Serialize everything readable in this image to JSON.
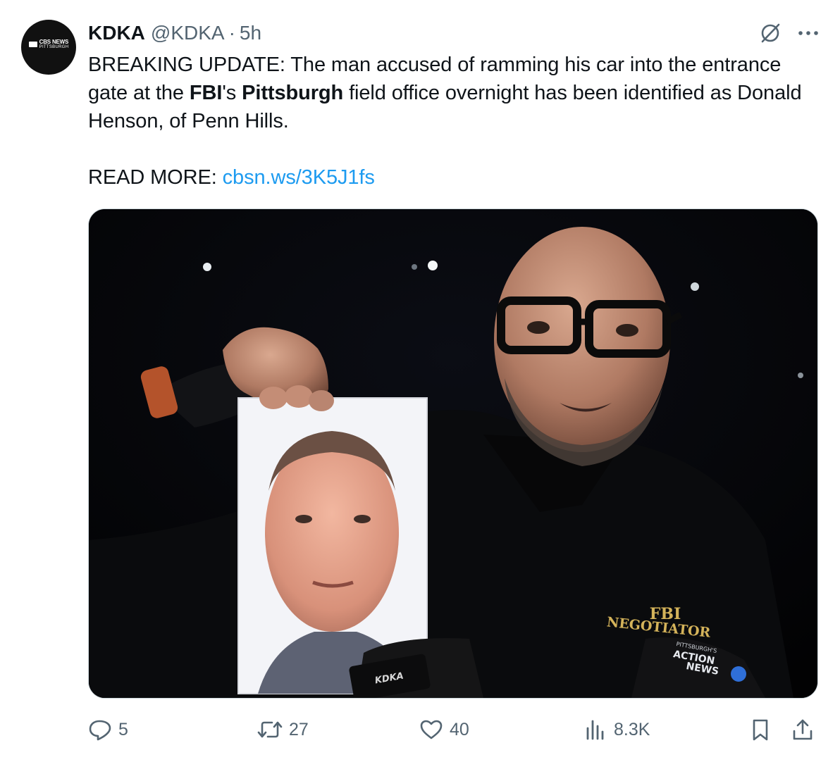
{
  "tweet": {
    "name": "KDKA",
    "handle": "@KDKA",
    "separator": "·",
    "time": "5h",
    "avatar_logo_line1": "CBS NEWS",
    "avatar_logo_line2": "PITTSBURGH",
    "text_segments": [
      "BREAKING UPDATE: The man accused of ramming his car into the entrance gate at the ",
      "FBI",
      "'s ",
      "Pittsburgh",
      " field office overnight has been identified as Donald Henson, of Penn Hills."
    ],
    "read_more_label": "READ MORE:",
    "link_text": "cbsn.ws/3K5J1fs"
  },
  "media": {
    "jacket_text_line1": "FBI",
    "jacket_text_line2": "NEGOTIATOR",
    "mic_left_label": "KDKA",
    "mic_right_label_1": "PITTSBURGH'S",
    "mic_right_label_2": "ACTION",
    "mic_right_label_3": "NEWS"
  },
  "actions": {
    "replies": "5",
    "retweets": "27",
    "likes": "40",
    "views": "8.3K"
  },
  "icons": [
    "grok-icon",
    "more-icon",
    "reply-icon",
    "retweet-icon",
    "like-icon",
    "views-icon",
    "bookmark-icon",
    "share-icon"
  ],
  "colors": {
    "text": "#0f1419",
    "secondary": "#536471",
    "link": "#1d9bf0",
    "border": "#cfd9de"
  }
}
